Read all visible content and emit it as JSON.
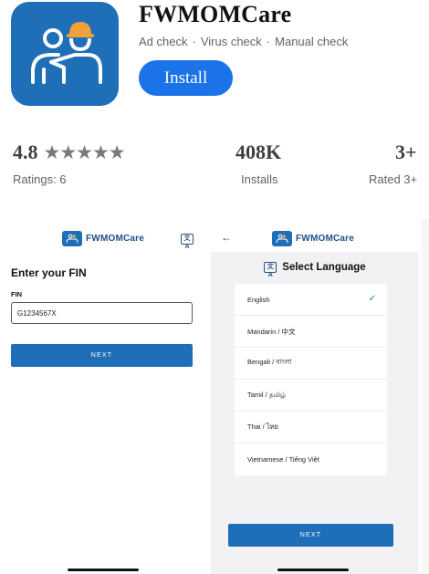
{
  "app": {
    "name": "FWMOMCare",
    "tags": [
      "Ad check",
      "Virus check",
      "Manual check"
    ],
    "install_label": "Install",
    "icon": "worker-with-helmet-icon",
    "colors": {
      "icon_bg": "#1f6fb8",
      "install_bg": "#1a73e8"
    }
  },
  "stats": {
    "rating_value": "4.8",
    "rating_stars": "★★★★★",
    "rating_label": "Ratings: 6",
    "installs_value": "408K",
    "installs_label": "Installs",
    "age_value": "3+",
    "age_label": "Rated 3+"
  },
  "screen1": {
    "logo_text": "FWMOMCare",
    "translate_icon_text": "文A",
    "title": "Enter your FIN",
    "field_label": "FIN",
    "field_value": "G1234567X",
    "next_label": "NEXT"
  },
  "screen2": {
    "logo_text": "FWMOMCare",
    "back_icon": "←",
    "translate_icon_text": "文A",
    "title": "Select Language",
    "languages": [
      "English",
      "Mandarin / 中文",
      "Bengali / বাংলা",
      "Tamil / தமிழ்",
      "Thai / ไทย",
      "Vietnamese / Tiếng Việt"
    ],
    "selected_mark": "✓",
    "next_label": "NEXT"
  }
}
